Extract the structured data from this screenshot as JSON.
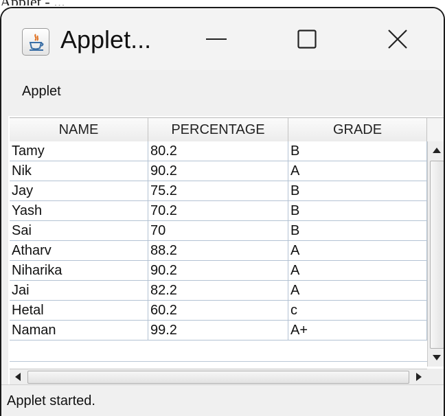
{
  "background_caption": "Applet - ...",
  "window": {
    "title": "Applet...",
    "menu_label": "Applet",
    "status": "Applet started."
  },
  "table": {
    "columns": [
      "NAME",
      "PERCENTAGE",
      "GRADE"
    ],
    "rows": [
      {
        "name": "Tamy",
        "percentage": "80.2",
        "grade": "B"
      },
      {
        "name": "Nik",
        "percentage": "90.2",
        "grade": "A"
      },
      {
        "name": "Jay",
        "percentage": "75.2",
        "grade": "B"
      },
      {
        "name": "Yash",
        "percentage": "70.2",
        "grade": "B"
      },
      {
        "name": "Sai",
        "percentage": "70",
        "grade": "B"
      },
      {
        "name": "Atharv",
        "percentage": "88.2",
        "grade": "A"
      },
      {
        "name": "Niharika",
        "percentage": "90.2",
        "grade": "A"
      },
      {
        "name": "Jai",
        "percentage": "82.2",
        "grade": "A"
      },
      {
        "name": "Hetal",
        "percentage": "60.2",
        "grade": "c"
      },
      {
        "name": "Naman",
        "percentage": "99.2",
        "grade": "A+"
      }
    ]
  },
  "icons": {
    "app": "java-cup-icon",
    "minimize": "minimize-icon",
    "maximize": "maximize-icon",
    "close": "close-icon"
  },
  "colors": {
    "window_frame": "#1a1a1a",
    "grid_line": "#b3c2d3"
  }
}
